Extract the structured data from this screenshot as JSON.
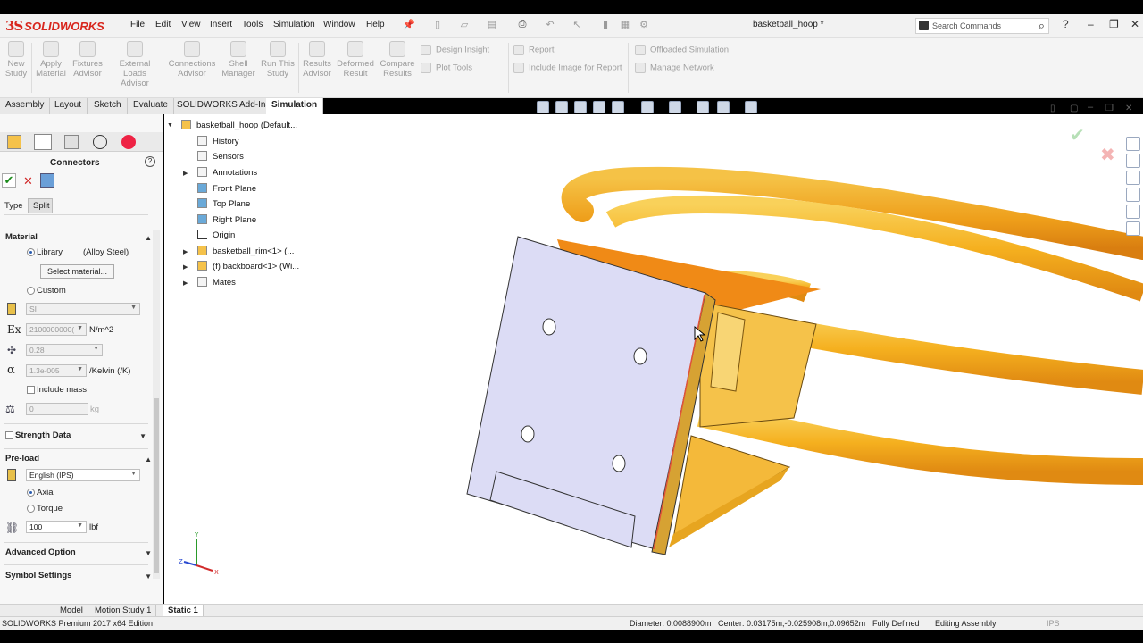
{
  "app": {
    "logo_ds": "3S",
    "logo_name": "SOLIDWORKS",
    "doc_title": "basketball_hoop *"
  },
  "menu": [
    "File",
    "Edit",
    "View",
    "Insert",
    "Tools",
    "Simulation",
    "Window",
    "Help"
  ],
  "search": {
    "placeholder": "Search Commands"
  },
  "ribbon": {
    "buttons": [
      {
        "label1": "New",
        "label2": "Study"
      },
      {
        "label1": "Apply",
        "label2": "Material"
      },
      {
        "label1": "Fixtures",
        "label2": "Advisor"
      },
      {
        "label1": "External Loads",
        "label2": "Advisor"
      },
      {
        "label1": "Connections",
        "label2": "Advisor"
      },
      {
        "label1": "Shell",
        "label2": "Manager"
      },
      {
        "label1": "Run This",
        "label2": "Study"
      },
      {
        "label1": "Results",
        "label2": "Advisor"
      },
      {
        "label1": "Deformed",
        "label2": "Result"
      },
      {
        "label1": "Compare",
        "label2": "Results"
      }
    ],
    "lines": [
      "Design Insight",
      "Plot Tools",
      "Report",
      "Include Image for Report",
      "Offloaded Simulation",
      "Manage Network"
    ]
  },
  "tabs": [
    "Assembly",
    "Layout",
    "Sketch",
    "Evaluate",
    "SOLIDWORKS Add-Ins",
    "Simulation"
  ],
  "property_manager": {
    "title": "Connectors",
    "subtabs": [
      "Type",
      "Split"
    ],
    "material": {
      "header": "Material",
      "library_label": "Library",
      "library_value": "(Alloy Steel)",
      "select_button": "Select material...",
      "custom_label": "Custom",
      "units": "SI",
      "ex_value": "2100000000(",
      "ex_unit": "N/m^2",
      "nu_value": "0.28",
      "alpha_value": "1.3e-005",
      "alpha_unit": "/Kelvin (/K)",
      "include_mass": "Include mass",
      "mass_value": "0",
      "mass_unit": "kg",
      "ex_symbol": "Ex",
      "alpha_symbol": "α"
    },
    "strength_data": "Strength Data",
    "preload": {
      "header": "Pre-load",
      "units": "English (IPS)",
      "axial": "Axial",
      "torque": "Torque",
      "value": "100",
      "unit": "lbf"
    },
    "advanced_option": "Advanced Option",
    "symbol_settings": "Symbol Settings"
  },
  "tree": {
    "root": "basketball_hoop  (Default...",
    "items": [
      "History",
      "Sensors",
      "Annotations",
      "Front Plane",
      "Top Plane",
      "Right Plane",
      "Origin",
      "basketball_rim<1> (...",
      "(f) backboard<1> (Wi...",
      "Mates"
    ]
  },
  "motion_tabs": [
    "Model",
    "Motion Study 1",
    "Static 1"
  ],
  "status": {
    "edition": "SOLIDWORKS Premium 2017 x64 Edition",
    "diameter": "Diameter: 0.0088900m",
    "center": "Center: 0.03175m,-0.025908m,0.09652m",
    "defined": "Fully Defined",
    "mode": "Editing Assembly",
    "units": "IPS"
  },
  "colors": {
    "accent": "#d8261d",
    "part_orange": "#f5b731",
    "plate": "#dcdcf5"
  }
}
